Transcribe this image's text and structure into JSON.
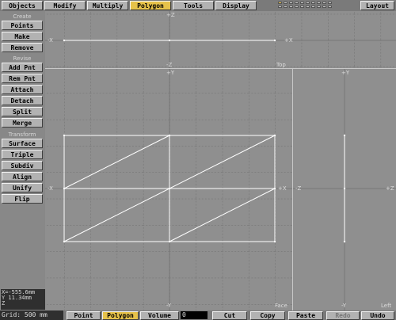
{
  "tabs": [
    "Objects",
    "Modify",
    "Multiply",
    "Polygon",
    "Tools",
    "Display"
  ],
  "active_tab": "Polygon",
  "layout_label": "Layout",
  "sections": {
    "create": {
      "title": "Create",
      "buttons": [
        "Points",
        "Make",
        "Remove"
      ]
    },
    "revise": {
      "title": "Revise",
      "buttons": [
        "Add Pnt",
        "Rem Pnt",
        "Attach",
        "Detach",
        "Split",
        "Merge"
      ]
    },
    "transform": {
      "title": "Transform",
      "buttons": [
        "Surface",
        "Triple",
        "Subdiv",
        "Align",
        "Unify",
        "Flip"
      ]
    }
  },
  "viewports": {
    "top": {
      "name": "Top",
      "axis_left": "-X",
      "axis_right": "+X",
      "axis_up": "+Z",
      "axis_down": "-Z"
    },
    "face": {
      "name": "Face",
      "axis_left": "-X",
      "axis_right": "+X",
      "axis_up": "+Y",
      "axis_down": "-Y"
    },
    "left": {
      "name": "Left",
      "axis_left": "-Z",
      "axis_right": "+Z",
      "axis_up": "+Y",
      "axis_down": "-Y"
    }
  },
  "readout": {
    "x": "X=-555.6mm",
    "y": "Y 11.34mm",
    "z": "Z"
  },
  "grid": "Grid: 500 mm",
  "selection_modes": [
    "Point",
    "Polygon",
    "Volume"
  ],
  "active_mode": "Polygon",
  "volume_value": "0",
  "edit_buttons": [
    "Cut",
    "Copy",
    "Paste",
    "Redo",
    "Undo"
  ],
  "colors": {
    "active": "#e6c24a",
    "viewport_bg": "#8f8f8f",
    "grid_dark": "#6e6e6e",
    "wire": "#ffffff"
  }
}
